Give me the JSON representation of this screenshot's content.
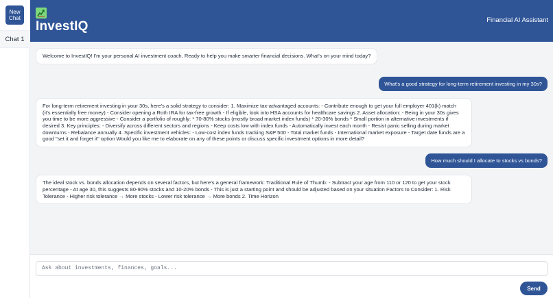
{
  "sidebar": {
    "new_chat_label": "New\nChat",
    "chats": [
      {
        "label": "Chat 1"
      }
    ]
  },
  "header": {
    "title": "InvestIQ",
    "subtitle": "Financial AI Assistant",
    "logo_icon": "chart-trending-up-icon"
  },
  "messages": [
    {
      "role": "assistant",
      "text": "Welcome to InvestIQ! I'm your personal AI investment coach. Ready to help you make smarter financial decisions. What's on your mind today?"
    },
    {
      "role": "user",
      "text": "What's a good strategy for long-term retirement investing in my 30s?"
    },
    {
      "role": "assistant",
      "text": "For long-term retirement investing in your 30s, here's a solid strategy to consider: 1. Maximize tax-advantaged accounts: - Contribute enough to get your full employer 401(k) match (it's essentially free money) - Consider opening a Roth IRA for tax-free growth - If eligible, look into HSA accounts for healthcare savings 2. Asset allocation: - Being in your 30s gives you time to be more aggressive - Consider a portfolio of roughly: * 70-80% stocks (mostly broad market index funds) * 20-30% bonds * Small portion in alternative investments if desired 3. Key principles: - Diversify across different sectors and regions - Keep costs low with index funds - Automatically invest each month - Resist panic selling during market downturns - Rebalance annually 4. Specific investment vehicles: - Low-cost index funds tracking S&P 500 - Total market funds - International market exposure - Target date funds are a good \"set it and forget it\" option Would you like me to elaborate on any of these points or discuss specific investment options in more detail?"
    },
    {
      "role": "user",
      "text": "How much should I allocate to stocks vs bonds?"
    },
    {
      "role": "assistant",
      "text": "The ideal stock vs. bonds allocation depends on several factors, but here's a general framework: Traditional Rule of Thumb: - Subtract your age from 110 or 120 to get your stock percentage - At age 30, this suggests 80-90% stocks and 10-20% bonds - This is just a starting point and should be adjusted based on your situation Factors to Consider: 1. Risk Tolerance - Higher risk tolerance → More stocks - Lower risk tolerance → More bonds 2. Time Horizon"
    }
  ],
  "input": {
    "placeholder": "Ask about investments, finances, goals...",
    "value": ""
  },
  "send_label": "Send",
  "colors": {
    "brand": "#2f5597",
    "logo": "#7dd87b",
    "background": "#f3f4f6"
  }
}
